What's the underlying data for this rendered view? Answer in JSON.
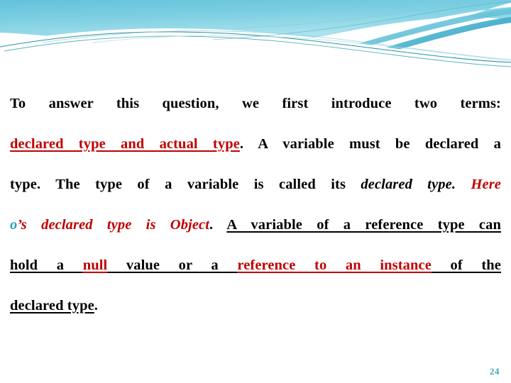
{
  "slide": {
    "page_number": "24",
    "accent_color": "#3AA8C1",
    "highlight_color": "#C00000",
    "body_color": "#000000",
    "background_color": "#FFFFFF",
    "banner": {
      "name": "wave-banner",
      "gradient_top": "#6EC6DE",
      "gradient_bottom": "#A9E3EE",
      "stroke_color": "#1E8C9C"
    },
    "lines": {
      "line1": {
        "seg1": "To answer this question, we first introduce two terms:"
      },
      "line2": {
        "seg1": "declared type and actual type",
        "seg2": ". A variable must be declared a"
      },
      "line3": {
        "seg1": "type. The type of a variable is called its ",
        "seg2": "declared type.",
        "seg3": " Here"
      },
      "line4": {
        "seg1": "o",
        "seg2": "’s declared type is Object",
        "seg3": ". ",
        "seg4": "A variable of a reference type can"
      },
      "line5": {
        "seg1": "hold a ",
        "seg2": "null",
        "seg3": " value or a ",
        "seg4": "reference to an instance",
        "seg5": " of the"
      },
      "line6": {
        "seg1": "declared type",
        "seg2": "."
      }
    }
  }
}
